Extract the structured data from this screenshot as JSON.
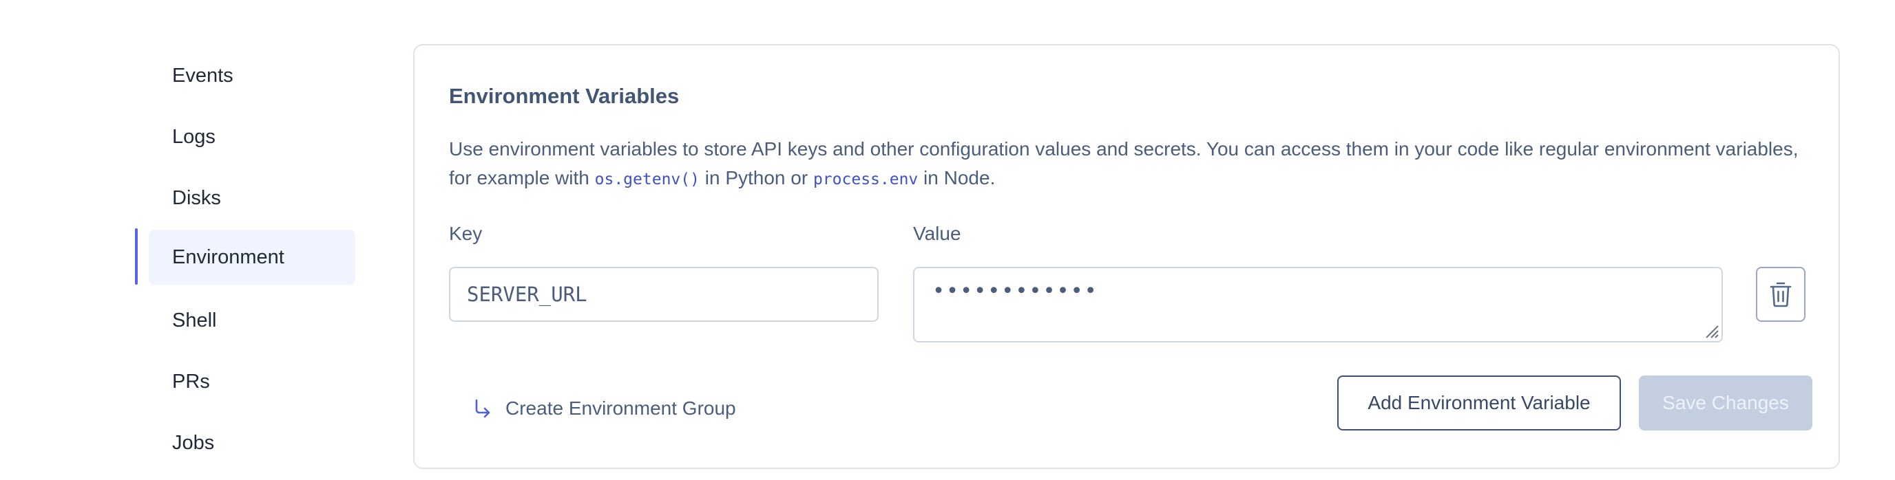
{
  "sidebar": {
    "items": [
      {
        "label": "Events"
      },
      {
        "label": "Logs"
      },
      {
        "label": "Disks"
      },
      {
        "label": "Environment",
        "active": true
      },
      {
        "label": "Shell"
      },
      {
        "label": "PRs"
      },
      {
        "label": "Jobs"
      }
    ]
  },
  "env": {
    "title": "Environment Variables",
    "desc_part1": "Use environment variables to store API keys and other configuration values and secrets. You can access them in your code like regular environment variables, for example with ",
    "code1": "os.getenv()",
    "desc_part2": " in Python or ",
    "code2": "process.env",
    "desc_part3": " in Node.",
    "key_label": "Key",
    "value_label": "Value",
    "key_value": "SERVER_URL",
    "value_masked": "••••••••••••",
    "create_group_label": "Create Environment Group",
    "add_button_label": "Add Environment Variable",
    "save_button_label": "Save Changes"
  },
  "icons": {
    "delete": "trash-icon",
    "create_group": "arrow-turn-down-right-icon"
  },
  "colors": {
    "accent": "#5b64e8",
    "active_bg": "#eff4fe",
    "save_disabled_bg": "#c3cfe1"
  }
}
